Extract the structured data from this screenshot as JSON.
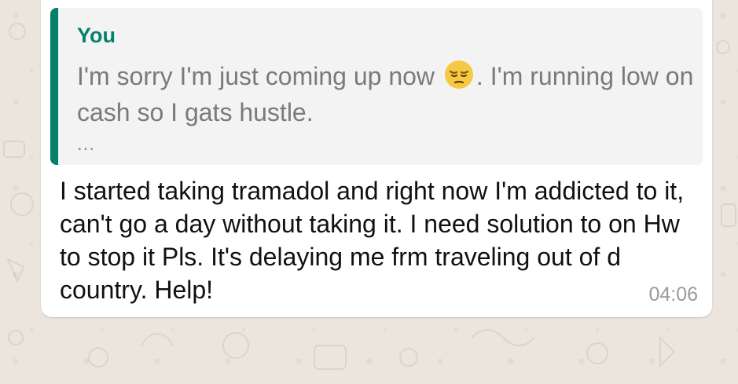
{
  "message": {
    "quoted": {
      "author": "You",
      "text_before_emoji": "I'm sorry I'm just coming up now",
      "emoji": "pensive-face",
      "text_after_emoji": ". I'm running low on cash so I gats hustle.",
      "ellipsis": "..."
    },
    "body": "I started taking tramadol and right now I'm addicted to it, can't go a day without taking it. I need solution to on Hw to stop it Pls. It's delaying me frm traveling out of d country. Help!",
    "time": "04:06"
  },
  "colors": {
    "chat_background": "#ece5dd",
    "quote_accent": "#06806b",
    "bubble": "#ffffff"
  }
}
